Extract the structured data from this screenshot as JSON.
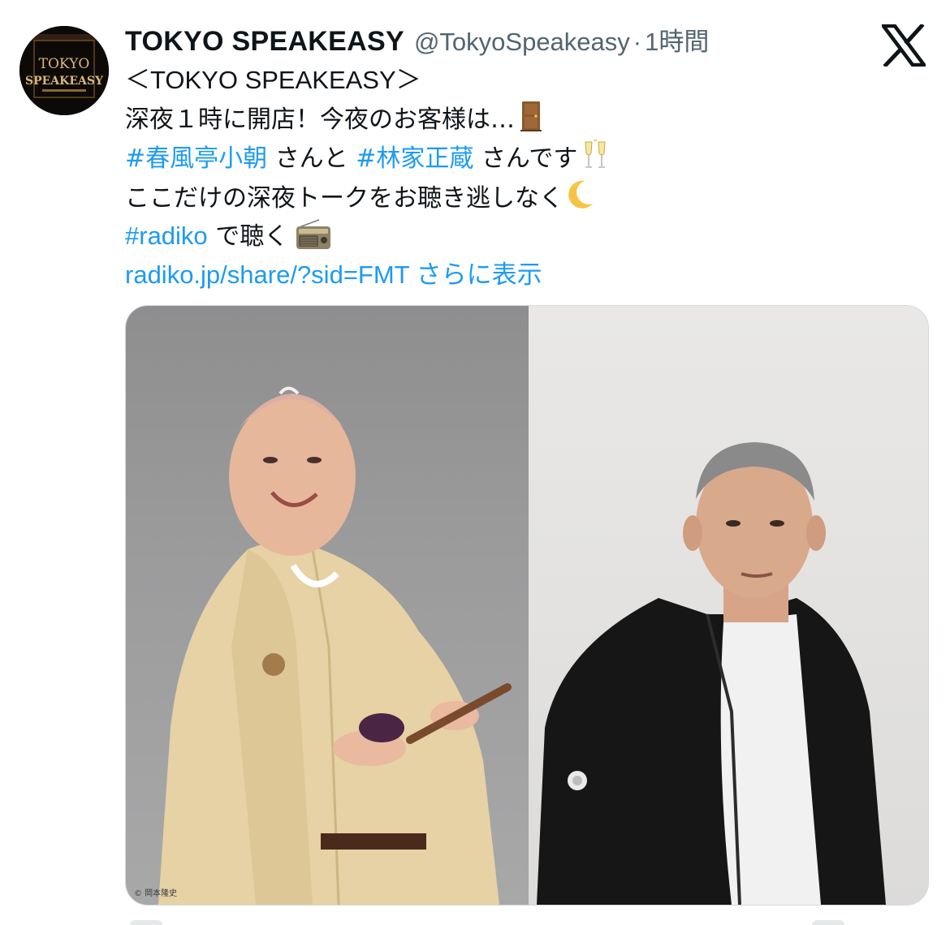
{
  "tweet": {
    "display_name": "TOKYO SPEAKEASY",
    "handle": "@TokyoSpeakeasy",
    "separator": "·",
    "time": "1時間",
    "avatar_icon": "tokyo-speakeasy-logo",
    "avatar_logo_lines": [
      "TOKYO",
      "SPEAKEASY"
    ],
    "platform_icon": "x-logo-icon",
    "body": {
      "line1": "＜TOKYO SPEAKEASY＞",
      "line2_text": "深夜１時に開店！今夜のお客様は…",
      "line2_emoji": "door-emoji",
      "line3_hashtag1": "#春風亭小朝",
      "line3_text1": " さんと ",
      "line3_hashtag2": "#林家正蔵",
      "line3_text2": " さんです",
      "line3_emoji": "clinking-glasses-emoji",
      "line4_text": "ここだけの深夜トークをお聴き逃しなく",
      "line4_emoji": "crescent-moon-emoji",
      "line5_hashtag": "#radiko",
      "line5_text": " で聴く",
      "line5_emoji": "radio-emoji",
      "line6_link": "radiko.jp/share/?sid=FMT",
      "line6_more": " さらに表示"
    },
    "media": {
      "left_photo": "photo-man-in-kimono",
      "right_photo": "photo-man-in-black-jacket",
      "credit": "© 岡本隆史"
    }
  },
  "colors": {
    "link": "#1d9bf0",
    "text": "#0f1419",
    "secondary": "#536471"
  }
}
